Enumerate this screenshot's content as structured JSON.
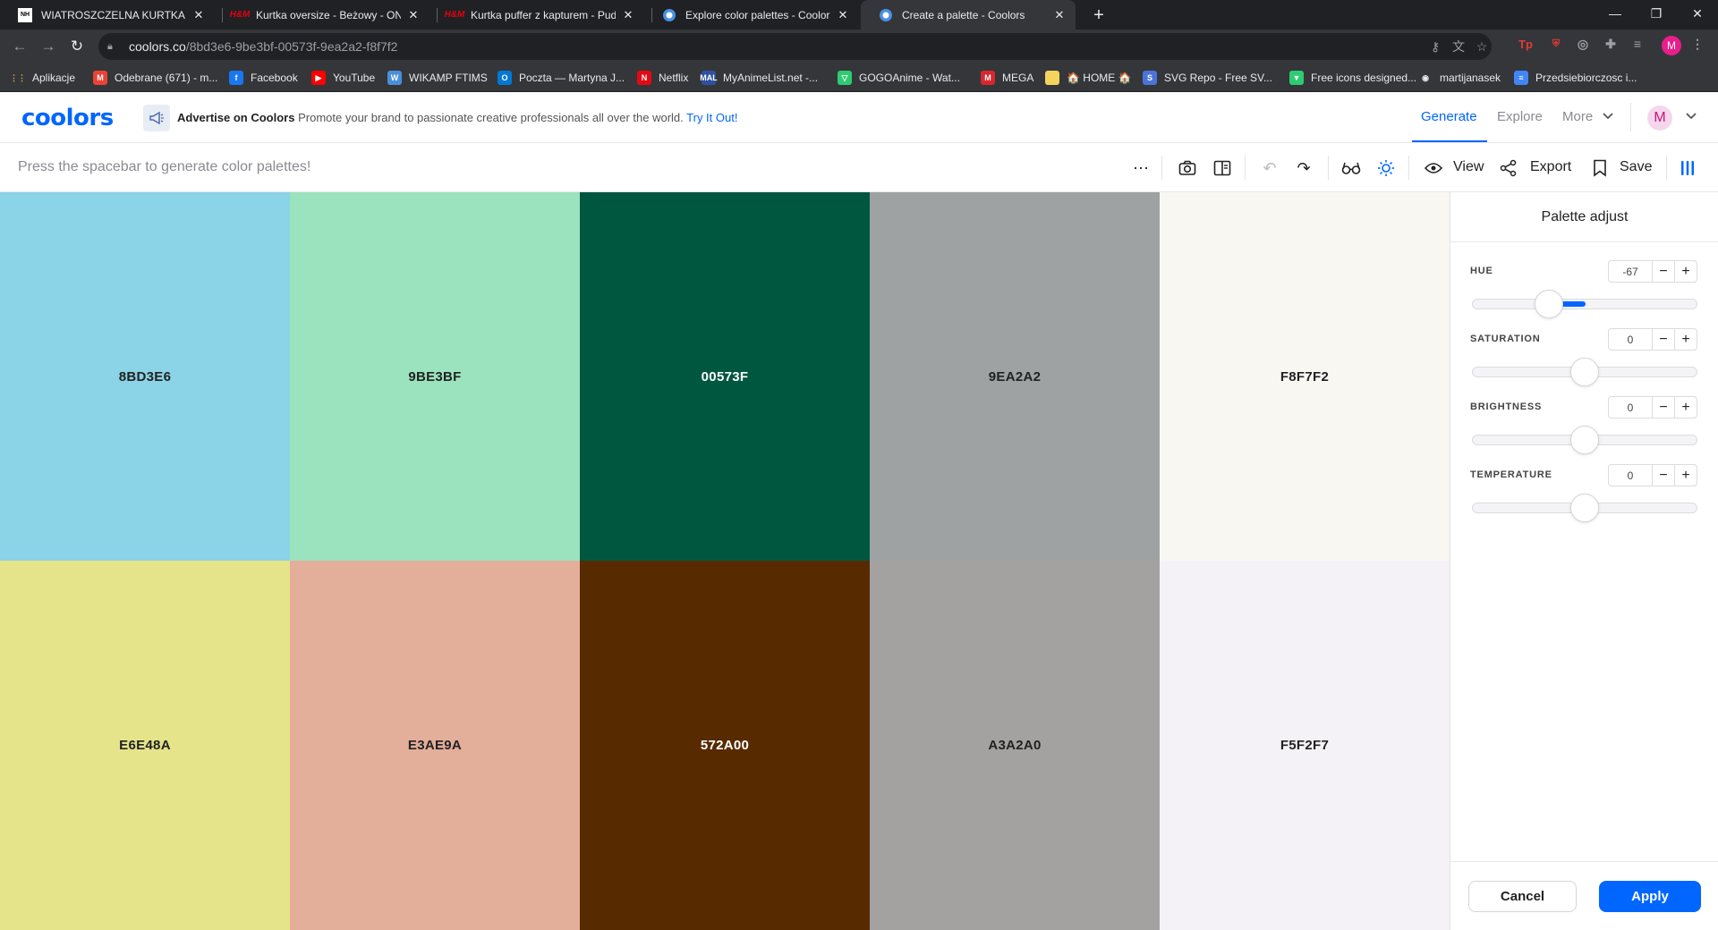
{
  "browser": {
    "tabs": [
      {
        "title": "WIATROSZCZELNA KURTKA PUCH",
        "icon": "page-icon"
      },
      {
        "title": "Kurtka oversize - Beżowy - ONA",
        "icon": "hm-icon"
      },
      {
        "title": "Kurtka puffer z kapturem - Pudro",
        "icon": "hm-icon"
      },
      {
        "title": "Explore color palettes - Coolors",
        "icon": "coolors-icon"
      },
      {
        "title": "Create a palette - Coolors",
        "icon": "coolors-icon"
      }
    ],
    "url_host": "coolors.co",
    "url_path": "/8bd3e6-9be3bf-00573f-9ea2a2-f8f7f2",
    "profile_initial": "M",
    "bookmarks": [
      {
        "label": "Aplikacje",
        "icon": "apps-icon",
        "color": "#e8eaed"
      },
      {
        "label": "Odebrane (671) - m...",
        "icon": "gmail-icon",
        "color": "#ea4335"
      },
      {
        "label": "Facebook",
        "icon": "facebook-icon",
        "color": "#1877f2"
      },
      {
        "label": "YouTube",
        "icon": "youtube-icon",
        "color": "#ff0000"
      },
      {
        "label": "WIKAMP FTIMS",
        "icon": "wikamp-icon",
        "color": "#4a90d9"
      },
      {
        "label": "Poczta — Martyna J...",
        "icon": "outlook-icon",
        "color": "#0078d4"
      },
      {
        "label": "Netflix",
        "icon": "netflix-icon",
        "color": "#e50914"
      },
      {
        "label": "MyAnimeList.net -...",
        "icon": "mal-icon",
        "color": "#2e51a2"
      },
      {
        "label": "GOGOAnime - Wat...",
        "icon": "gogo-icon",
        "color": "#2ecc71"
      },
      {
        "label": "MEGA",
        "icon": "mega-icon",
        "color": "#d9272e"
      },
      {
        "label": "🏠 HOME 🏠",
        "icon": "folder-icon",
        "color": "#f4d35e"
      },
      {
        "label": "SVG Repo - Free SV...",
        "icon": "svgrepo-icon",
        "color": "#4a74d9"
      },
      {
        "label": "Free icons designed...",
        "icon": "flaticon-icon",
        "color": "#2ecc71"
      },
      {
        "label": "martijanasek",
        "icon": "github-icon",
        "color": "#e8eaed"
      },
      {
        "label": "Przedsiebiorczosc i...",
        "icon": "docs-icon",
        "color": "#4285f4"
      }
    ]
  },
  "header": {
    "logo": "coolors",
    "ad_title": "Advertise on Coolors",
    "ad_desc": "Promote your brand to passionate creative professionals all over the world.",
    "ad_link": "Try It Out!",
    "nav": [
      "Generate",
      "Explore",
      "More"
    ],
    "avatar_initial": "M"
  },
  "toolbar": {
    "hint": "Press the spacebar to generate color palettes!",
    "view_label": "View",
    "export_label": "Export",
    "save_label": "Save"
  },
  "palette": {
    "rows": [
      [
        {
          "hex": "8BD3E6",
          "color": "#8bd3e6",
          "dark": false
        },
        {
          "hex": "9BE3BF",
          "color": "#9be3bf",
          "dark": false
        },
        {
          "hex": "00573F",
          "color": "#00573f",
          "dark": true
        },
        {
          "hex": "9EA2A2",
          "color": "#9ea2a2",
          "dark": false
        },
        {
          "hex": "F8F7F2",
          "color": "#f8f7f2",
          "dark": false
        }
      ],
      [
        {
          "hex": "E6E48A",
          "color": "#e6e48a",
          "dark": false
        },
        {
          "hex": "E3AE9A",
          "color": "#e3ae9a",
          "dark": false
        },
        {
          "hex": "572A00",
          "color": "#572a00",
          "dark": true
        },
        {
          "hex": "A3A2A0",
          "color": "#a3a2a0",
          "dark": false
        },
        {
          "hex": "F5F2F7",
          "color": "#f5f2f7",
          "dark": false
        }
      ]
    ]
  },
  "adjust": {
    "title": "Palette adjust",
    "controls": [
      {
        "label": "HUE",
        "value": "-67",
        "position": 0.34,
        "fill_to": 0.5
      },
      {
        "label": "SATURATION",
        "value": "0",
        "position": 0.5
      },
      {
        "label": "BRIGHTNESS",
        "value": "0",
        "position": 0.5
      },
      {
        "label": "TEMPERATURE",
        "value": "0",
        "position": 0.5
      }
    ],
    "cancel_label": "Cancel",
    "apply_label": "Apply"
  },
  "colors": {
    "accent": "#0066ff"
  }
}
